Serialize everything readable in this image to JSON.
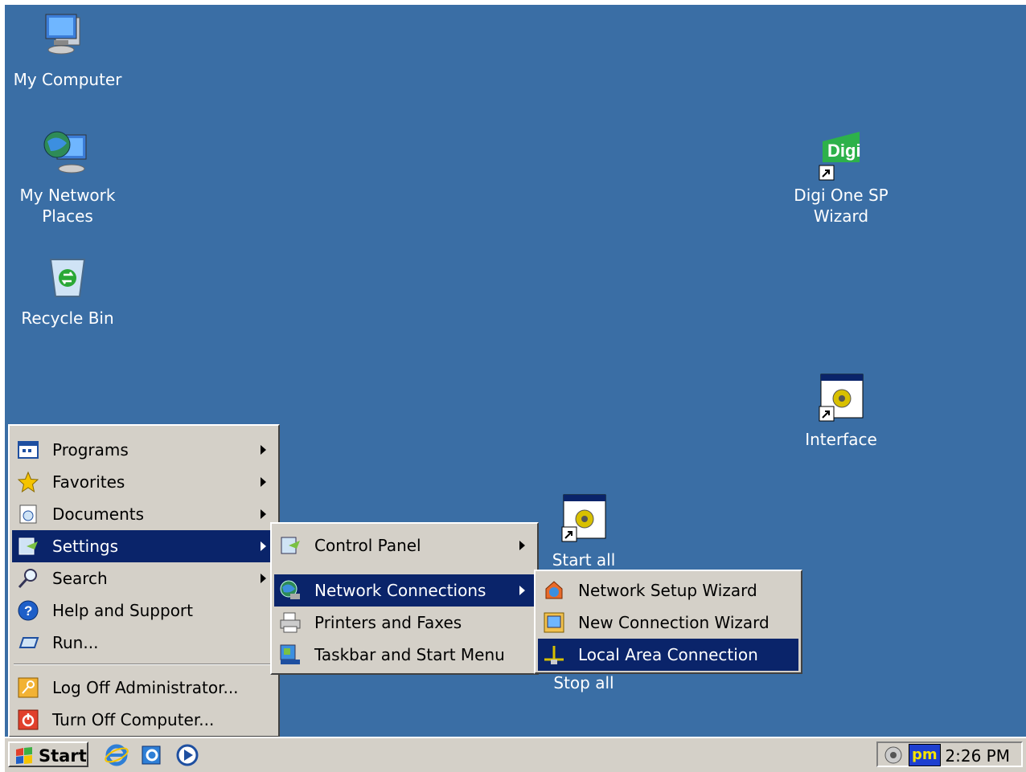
{
  "desktop": {
    "icons": {
      "my_computer": "My Computer",
      "my_network_line1": "My Network",
      "my_network_line2": "Places",
      "recycle_bin": "Recycle Bin",
      "digi_line1": "Digi One SP",
      "digi_line2": "Wizard",
      "digi_logo_text": "Digi",
      "interface": "Interface",
      "start_all": "Start all",
      "stop_all": "Stop all"
    }
  },
  "start_menu": {
    "items": [
      {
        "label": "Programs"
      },
      {
        "label": "Favorites"
      },
      {
        "label": "Documents"
      },
      {
        "label": "Settings"
      },
      {
        "label": "Search"
      },
      {
        "label": "Help and Support"
      },
      {
        "label": "Run..."
      },
      {
        "label": "Log Off Administrator..."
      },
      {
        "label": "Turn Off Computer..."
      }
    ]
  },
  "settings_menu": {
    "items": [
      {
        "label": "Control Panel"
      },
      {
        "label": "Network Connections"
      },
      {
        "label": "Printers and Faxes"
      },
      {
        "label": "Taskbar and Start Menu"
      }
    ]
  },
  "network_menu": {
    "items": [
      {
        "label": "Network Setup Wizard"
      },
      {
        "label": "New Connection Wizard"
      },
      {
        "label": "Local Area Connection"
      }
    ]
  },
  "taskbar": {
    "start_label": "Start",
    "tray_pm": "pm",
    "clock": "2:26 PM"
  },
  "colors": {
    "desktop": "#3a6ea5",
    "highlight": "#0a246a",
    "menu_face": "#d4d0c8"
  }
}
